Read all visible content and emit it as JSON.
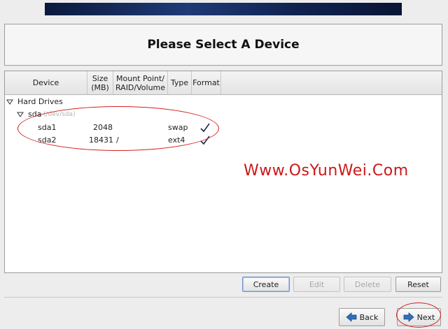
{
  "header": {
    "title": "Please Select A Device"
  },
  "columns": {
    "device": "Device",
    "size_line1": "Size",
    "size_line2": "(MB)",
    "mount_line1": "Mount Point/",
    "mount_line2": "RAID/Volume",
    "type": "Type",
    "format": "Format"
  },
  "tree": {
    "group_label": "Hard Drives",
    "disk": {
      "name": "sda",
      "path": "(/dev/sda)"
    },
    "partitions": [
      {
        "device": "sda1",
        "size": "2048",
        "mount": "",
        "type": "swap",
        "format": true
      },
      {
        "device": "sda2",
        "size": "18431",
        "mount": "/",
        "type": "ext4",
        "format": true
      }
    ]
  },
  "actions": {
    "create": "Create",
    "edit": "Edit",
    "delete": "Delete",
    "reset": "Reset"
  },
  "nav": {
    "back": "Back",
    "next": "Next"
  },
  "watermark": "Www.OsYunWei.Com",
  "colors": {
    "annotation_red": "#d42020",
    "watermark_red": "#cc1818",
    "arrow_blue": "#2f6fb8"
  },
  "icons": {
    "expand": "triangle-down-icon",
    "check": "checkmark-icon",
    "back": "arrow-left-icon",
    "next": "arrow-right-icon"
  }
}
